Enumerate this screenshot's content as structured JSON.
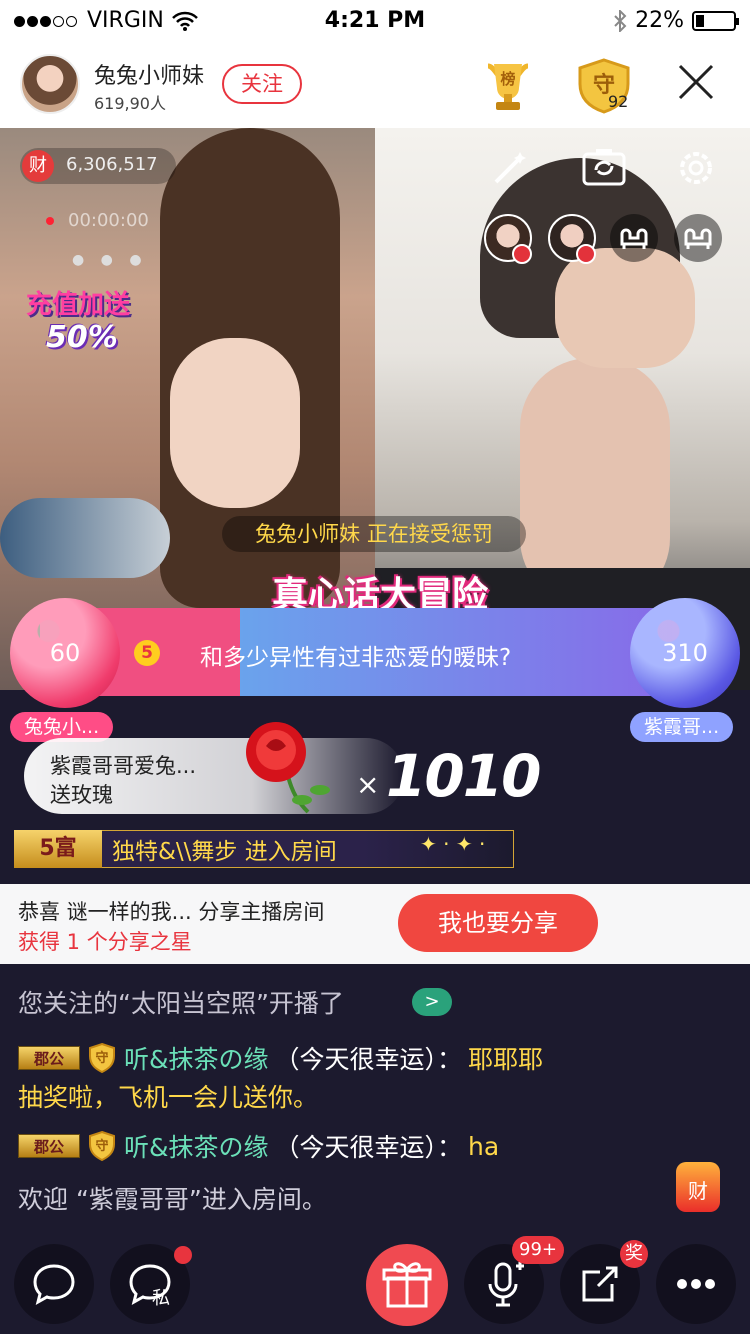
{
  "status_bar": {
    "carrier": "VIRGIN",
    "time": "4:21 PM",
    "battery": "22%"
  },
  "header": {
    "anchor_name": "兔兔小师妹",
    "audience_count": "619,90人",
    "follow_label": "关注",
    "rank_label": "榜",
    "guard_label": "守",
    "guard_count": "92"
  },
  "video": {
    "wealth_badge": "财",
    "wealth_value": "6,306,517",
    "record_time": "00:00:00",
    "promo_line1": "充值加送",
    "promo_line2": "50%",
    "punish_notice": "兔兔小师妹 正在接受惩罚",
    "game_title": "真心话大冒险",
    "left_score": "60",
    "right_score": "310",
    "question_number": "5",
    "question": "和多少异性有过非恋爱的暧昧?"
  },
  "pk": {
    "left_name": "兔兔小...",
    "right_name": "紫霞哥..."
  },
  "gift": {
    "sender_line": "紫霞哥哥爱兔...",
    "action_line": "送玫瑰",
    "multiplier": "×",
    "count": "1010"
  },
  "enter_notice": {
    "level_badge": "5富",
    "text": "独特&\\\\舞步 进入房间"
  },
  "share": {
    "line1": "恭喜 谜一样的我... 分享主播房间",
    "line2": "获得 1 个分享之星",
    "button": "我也要分享"
  },
  "chat": {
    "follow_notice": "您关注的“太阳当空照”开播了",
    "goto_icon": ">",
    "messages": [
      {
        "rank": "郡公",
        "guard": "守",
        "user": "听&抹茶の缘",
        "note": "（今天很幸运）：",
        "text_inline": "耶耶耶",
        "text_next": "抽奖啦，飞机一会儿送你。"
      },
      {
        "rank": "郡公",
        "guard": "守",
        "user": "听&抹茶の缘",
        "note": "（今天很幸运）：",
        "text_inline": "ha"
      }
    ],
    "welcome": "欢迎 “紫霞哥哥”进入房间。"
  },
  "floating": {
    "wealth": "财"
  },
  "bottom_bar": {
    "private_label": "私",
    "mic_badge": "99+",
    "share_badge": "奖"
  },
  "colors": {
    "accent_red": "#e8343e",
    "gold": "#ffd84a",
    "green_name": "#6be0b8",
    "bg": "#1c1a2e"
  }
}
